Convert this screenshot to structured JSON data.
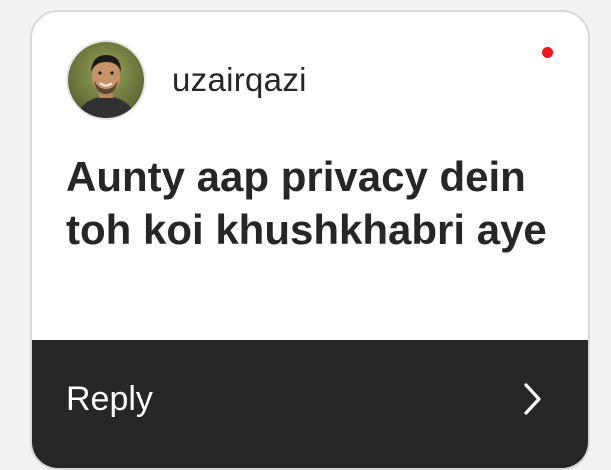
{
  "comment_card": {
    "username": "uzairqazi",
    "comment_text": "Aunty aap privacy dein toh koi khushkhabri aye",
    "reply_label": "Reply",
    "icons": {
      "avatar": "profile-avatar",
      "notification": "red-dot-icon",
      "chevron": "chevron-right-icon"
    }
  },
  "colors": {
    "card_background": "#ffffff",
    "text_primary": "#262626",
    "reply_bar": "#262626",
    "reply_text": "#ffffff",
    "notification_dot": "#f2141c"
  }
}
